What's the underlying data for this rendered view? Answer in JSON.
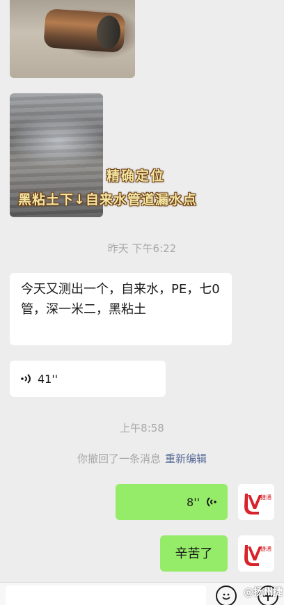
{
  "images": {
    "caption_line1": "精确定位",
    "caption_line2": "黑粘土下↓自来水管道漏水点"
  },
  "messages": {
    "yesterday_time": "昨天 下午6:22",
    "text_received": "今天又测出一个，自来水，PE，七0管，深一米二，黑粘土",
    "voice_received_duration": "41''",
    "morning_time": "上午8:58",
    "recall_notice": "你撤回了一条消息",
    "recall_edit_link": "重新编辑",
    "voice_sent_duration": "8''",
    "text_sent": "辛苦了"
  },
  "avatar": {
    "logo_text": "捷通",
    "brand_color": "#d8232a"
  },
  "watermark": "@扬州捷",
  "colors": {
    "background": "#ededed",
    "sent_bubble": "#95ec69",
    "link": "#576b95"
  }
}
